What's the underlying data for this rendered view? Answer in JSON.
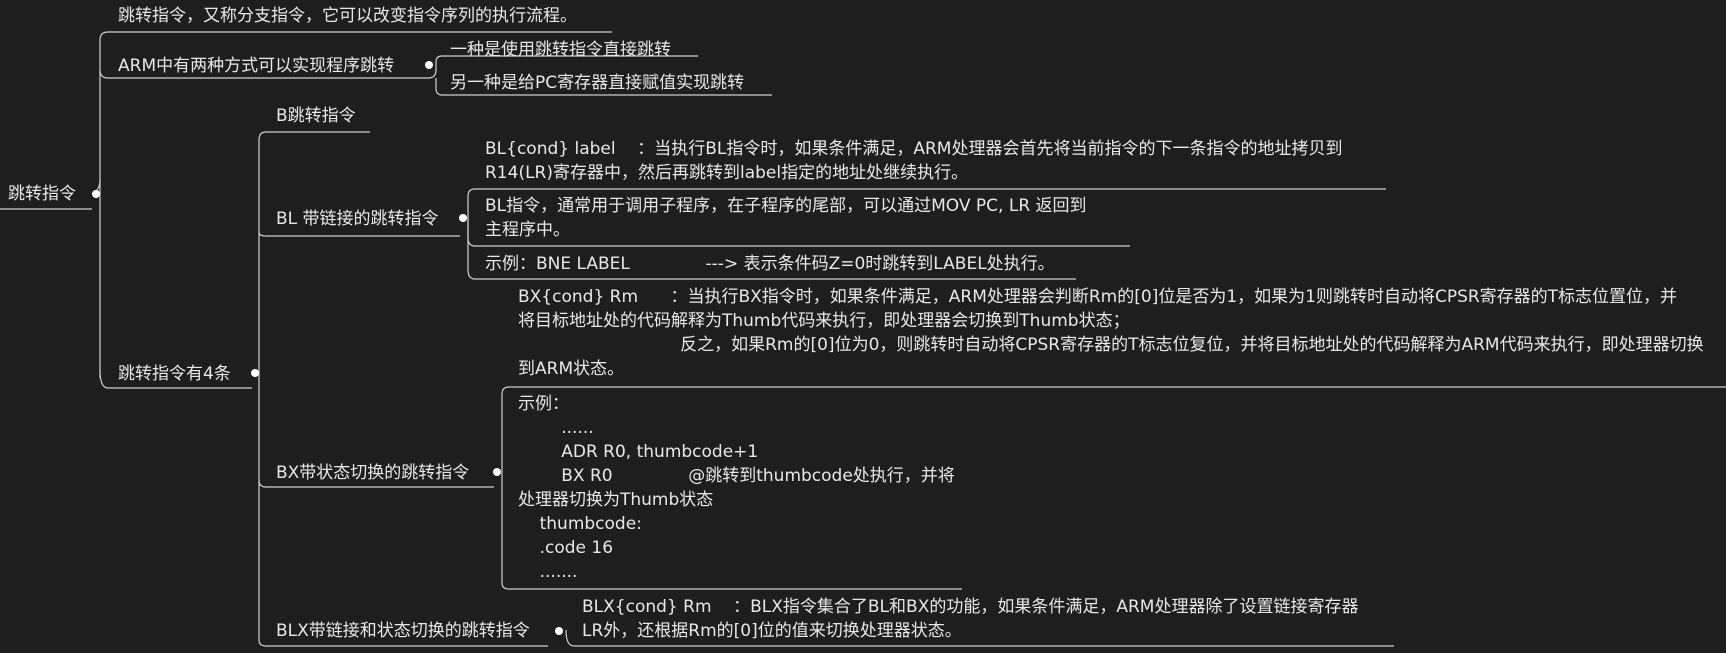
{
  "root": {
    "label": "跳转指令"
  },
  "nodes": {
    "intro": "跳转指令，又称分支指令，它可以改变指令序列的执行流程。",
    "arm_two_ways": {
      "label": "ARM中有两种方式可以实现程序跳转",
      "children": [
        "一种是使用跳转指令直接跳转",
        "另一种是给PC寄存器直接赋值实现跳转"
      ]
    },
    "four_kinds": {
      "label": "跳转指令有4条",
      "b": {
        "label": "B跳转指令"
      },
      "bl": {
        "label": "BL 带链接的跳转指令",
        "desc_lines": [
          "BL{cond} label    ：当执行BL指令时，如果条件满足，ARM处理器会首先将当前指令的下一条指令的地址拷贝到",
          "R14(LR)寄存器中，然后再跳转到label指定的地址处继续执行。"
        ],
        "usage_lines": [
          "BL指令，通常用于调用子程序，在子程序的尾部，可以通过MOV PC, LR 返回到",
          "主程序中。"
        ],
        "example": "示例：BNE LABEL              ---> 表示条件码Z=0时跳转到LABEL处执行。"
      },
      "bx": {
        "label": "BX带状态切换的跳转指令",
        "desc_lines": [
          "BX{cond} Rm      ：当执行BX指令时，如果条件满足，ARM处理器会判断Rm的[0]位是否为1，如果为1则跳转时自动将CPSR寄存器的T标志位置位，并",
          "将目标地址处的代码解释为Thumb代码来执行，即处理器会切换到Thumb状态；",
          "                              反之，如果Rm的[0]位为0，则跳转时自动将CPSR寄存器的T标志位复位，并将目标地址处的代码解释为ARM代码来执行，即处理器切换",
          "到ARM状态。"
        ],
        "example_lines": [
          "示例：",
          "        ......",
          "        ADR R0, thumbcode+1",
          "        BX R0              @跳转到thumbcode处执行，并将",
          "处理器切换为Thumb状态",
          "    thumbcode:",
          "    .code 16",
          "    ......."
        ]
      },
      "blx": {
        "label": "BLX带链接和状态切换的跳转指令",
        "desc_lines": [
          "BLX{cond} Rm    ：BLX指令集合了BL和BX的功能，如果条件满足，ARM处理器除了设置链接寄存器",
          "LR外，还根据Rm的[0]位的值来切换处理器状态。"
        ]
      }
    }
  },
  "colors": {
    "background": "#1e1e1e",
    "text": "#e8e8e8",
    "line": "#cfcfcf",
    "dot": "#ffffff"
  }
}
